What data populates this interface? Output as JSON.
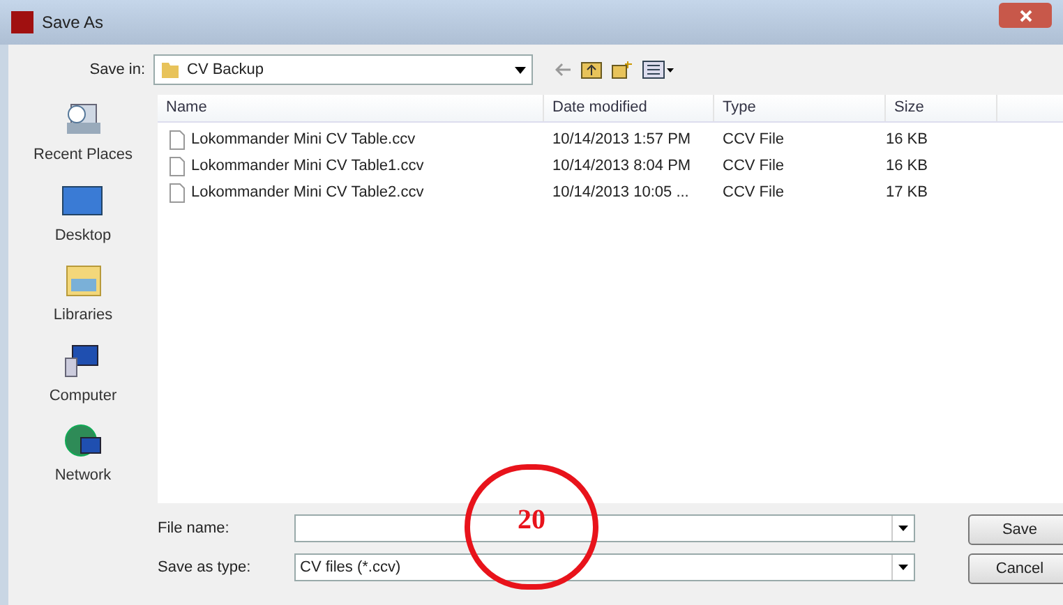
{
  "window": {
    "title": "Save As"
  },
  "toolbar": {
    "save_in_label": "Save in:",
    "save_in_value": "CV Backup"
  },
  "places": [
    {
      "label": "Recent Places",
      "kind": "recent"
    },
    {
      "label": "Desktop",
      "kind": "desktop"
    },
    {
      "label": "Libraries",
      "kind": "libraries"
    },
    {
      "label": "Computer",
      "kind": "computer"
    },
    {
      "label": "Network",
      "kind": "network"
    }
  ],
  "table": {
    "columns": [
      "Name",
      "Date modified",
      "Type",
      "Size"
    ],
    "rows": [
      [
        "Lokommander Mini CV Table.ccv",
        "10/14/2013 1:57 PM",
        "CCV File",
        "16 KB"
      ],
      [
        "Lokommander Mini CV Table1.ccv",
        "10/14/2013 8:04 PM",
        "CCV File",
        "16 KB"
      ],
      [
        "Lokommander Mini CV Table2.ccv",
        "10/14/2013 10:05 ...",
        "CCV File",
        "17 KB"
      ]
    ]
  },
  "file_name": {
    "label": "File name:"
  },
  "save_as_type": {
    "label": "Save as type:",
    "value": "CV files (*.ccv)"
  },
  "buttons": [
    "Save",
    "Cancel"
  ],
  "annotation": {
    "text": "20"
  }
}
